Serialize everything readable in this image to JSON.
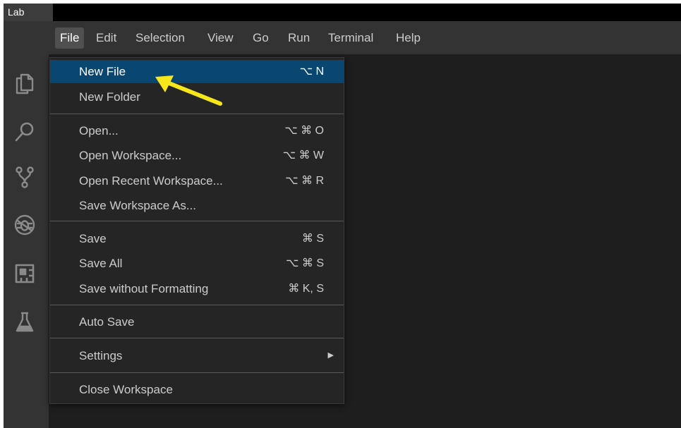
{
  "app": {
    "title": "Lab"
  },
  "menubar": {
    "items": [
      {
        "label": "File"
      },
      {
        "label": "Edit"
      },
      {
        "label": "Selection"
      },
      {
        "label": "View"
      },
      {
        "label": "Go"
      },
      {
        "label": "Run"
      },
      {
        "label": "Terminal"
      },
      {
        "label": "Help"
      }
    ]
  },
  "activitybar": {
    "icons": [
      "explorer-icon",
      "search-icon",
      "source-control-icon",
      "debug-icon",
      "extensions-icon",
      "testing-flask-icon"
    ]
  },
  "file_menu": {
    "items": [
      {
        "label": "New File",
        "shortcut": "⌥ N"
      },
      {
        "label": "New Folder",
        "shortcut": ""
      },
      {
        "label": "Open...",
        "shortcut": "⌥ ⌘ O"
      },
      {
        "label": "Open Workspace...",
        "shortcut": "⌥ ⌘ W"
      },
      {
        "label": "Open Recent Workspace...",
        "shortcut": "⌥ ⌘ R"
      },
      {
        "label": "Save Workspace As...",
        "shortcut": ""
      },
      {
        "label": "Save",
        "shortcut": "⌘ S"
      },
      {
        "label": "Save All",
        "shortcut": "⌥ ⌘ S"
      },
      {
        "label": "Save without Formatting",
        "shortcut": "⌘ K, S"
      },
      {
        "label": "Auto Save",
        "shortcut": ""
      },
      {
        "label": "Settings",
        "shortcut": ""
      },
      {
        "label": "Close Workspace",
        "shortcut": ""
      }
    ]
  },
  "colors": {
    "highlight": "#094771",
    "annotation_arrow": "#f5e71c"
  }
}
